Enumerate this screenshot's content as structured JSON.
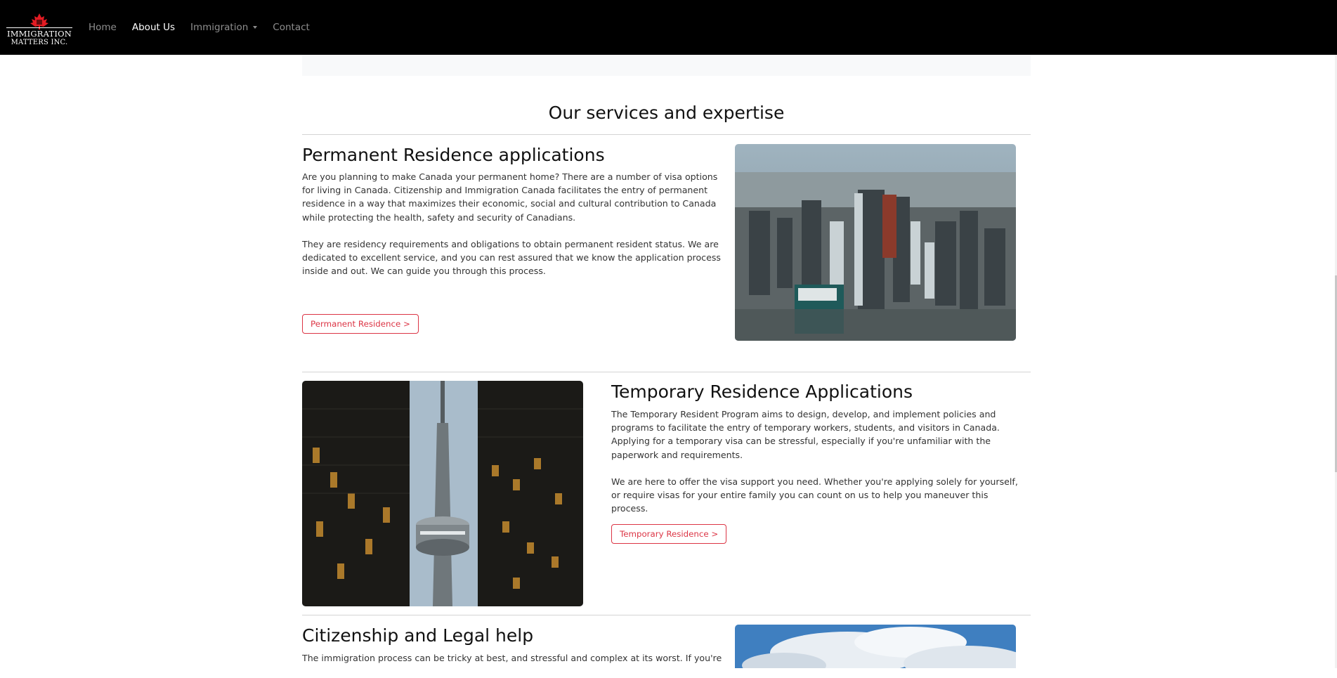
{
  "brand": {
    "line1": "IMMIGRATION",
    "line2": "MATTERS INC.",
    "logo_icon": "maple-leaf-icon",
    "accent": "#e31b23"
  },
  "nav": {
    "home": "Home",
    "about": "About Us",
    "immigration": "Immigration",
    "contact": "Contact"
  },
  "main": {
    "section_title": "Our services and expertise",
    "services": [
      {
        "title": "Permanent Residence applications",
        "paragraph1": "Are you planning to make Canada your permanent home? There are a number of visa options for living in Canada. Citizenship and Immigration Canada facilitates the entry of permanent residence in a way that maximizes their economic, social and cultural contribution to Canada while protecting the health, safety and security of Canadians.",
        "paragraph2": "They are residency requirements and obligations to obtain permanent resident status. We are dedicated to excellent service, and you can rest assured that we know the application process inside and out. We can guide you through this process.",
        "button": "Permanent Residence >"
      },
      {
        "title": "Temporary Residence Applications",
        "paragraph1": "The Temporary Resident Program aims to design, develop, and implement policies and programs to facilitate the entry of temporary workers, students, and visitors in Canada. Applying for a temporary visa can be stressful, especially if you're unfamiliar with the paperwork and requirements.",
        "paragraph2": "We are here to offer the visa support you need. Whether you're applying solely for yourself, or require visas for your entire family you can count on us to help you maneuver this process.",
        "button": "Temporary Residence >"
      },
      {
        "title": "Citizenship and Legal help",
        "paragraph1": "The immigration process can be tricky at best, and stressful and complex at its worst. If you're looking to"
      }
    ]
  },
  "colors": {
    "navbar_bg": "#000000",
    "button_accent": "#dc3545",
    "panel_bg": "#f8f9fa"
  }
}
